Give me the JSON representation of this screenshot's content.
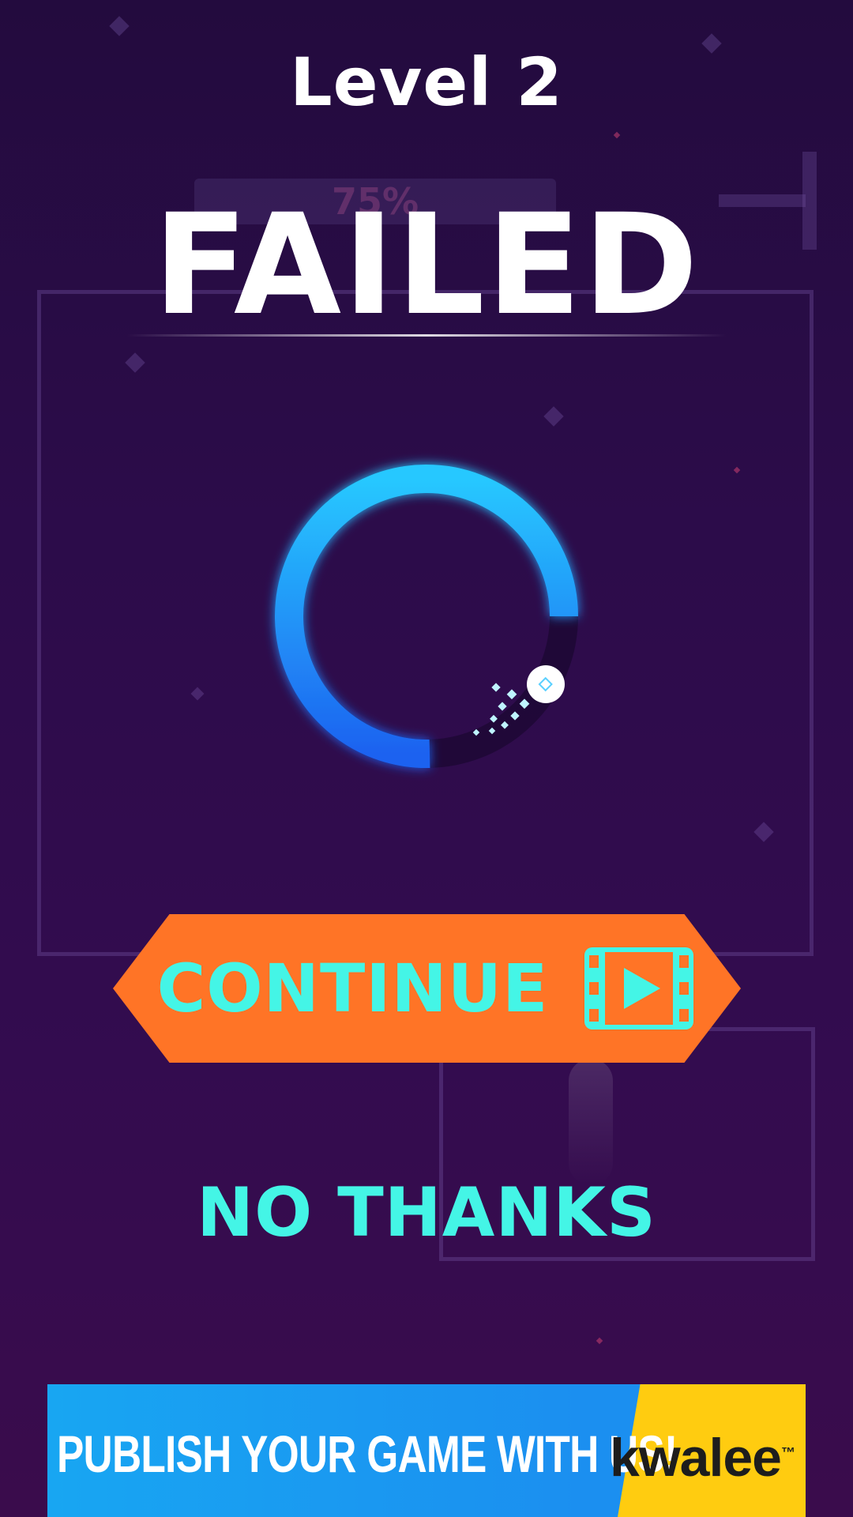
{
  "level": {
    "title": "Level 2"
  },
  "progress": {
    "label": "75%",
    "value": 75
  },
  "result": {
    "title": "FAILED"
  },
  "loader": {
    "fill_fraction": 0.72
  },
  "buttons": {
    "continue_label": "CONTINUE",
    "continue_icon": "video-play-icon",
    "no_thanks_label": "NO THANKS"
  },
  "ad": {
    "text": "PUBLISH YOUR GAME WITH US!",
    "brand": "kwalee",
    "brand_mark": "™"
  },
  "colors": {
    "background": "#2c0c4a",
    "accent_orange": "#ff7426",
    "accent_cyan": "#44f5e6",
    "ring_blue": "#1f8bff",
    "ad_blue": "#1b8ff0",
    "ad_yellow": "#ffcc10"
  }
}
